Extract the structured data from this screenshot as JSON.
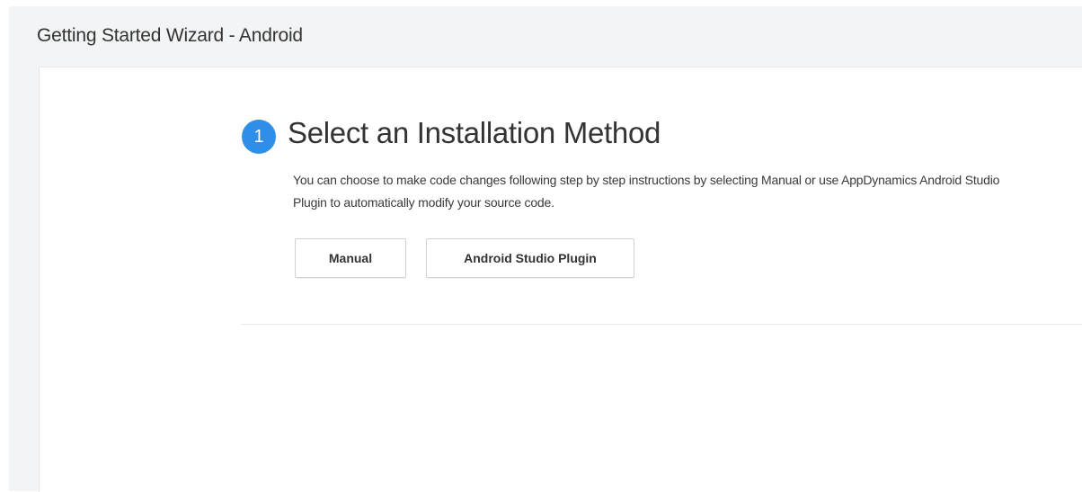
{
  "header": {
    "title": "Getting Started Wizard - Android"
  },
  "step": {
    "number": "1",
    "title": "Select an Installation Method",
    "description": "You can choose to make code changes following step by step instructions by selecting Manual or use AppDynamics Android Studio Plugin to automatically modify your source code.",
    "options": [
      {
        "label": "Manual"
      },
      {
        "label": "Android Studio Plugin"
      }
    ]
  },
  "colors": {
    "accent": "#2f8fe8",
    "frame_background": "#f3f4f5",
    "panel_background": "#ffffff",
    "text": "#333333"
  }
}
